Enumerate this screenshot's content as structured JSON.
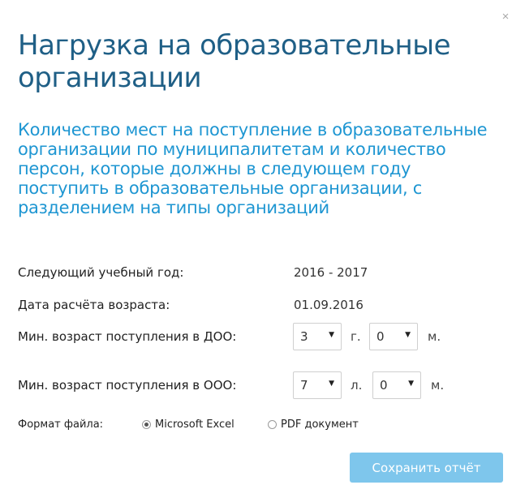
{
  "dialog": {
    "title": "Нагрузка на образовательные организации",
    "subtitle": "Количество мест на поступление в образовательные организации по муниципалитетам и количество персон, которые должны в следующем году поступить в образовательные организации, с разделением на типы организаций",
    "close_label": "×"
  },
  "fields": {
    "next_year_label": "Следующий учебный год:",
    "next_year_value": "2016 - 2017",
    "age_date_label": "Дата расчёта возраста:",
    "age_date_value": "01.09.2016",
    "doo_label": "Мин. возраст поступления в ДОО:",
    "doo_years": "3",
    "doo_years_unit": "г.",
    "doo_months": "0",
    "doo_months_unit": "м.",
    "ooo_label": "Мин. возраст поступления в ООО:",
    "ooo_years": "7",
    "ooo_years_unit": "л.",
    "ooo_months": "0",
    "ooo_months_unit": "м."
  },
  "format": {
    "label": "Формат файла:",
    "options": [
      {
        "label": "Microsoft Excel",
        "checked": true
      },
      {
        "label": "PDF документ",
        "checked": false
      }
    ]
  },
  "actions": {
    "save_label": "Сохранить отчёт"
  },
  "colors": {
    "title": "#1f5f86",
    "subtitle": "#1e96d2",
    "button": "#7ec6ec"
  }
}
